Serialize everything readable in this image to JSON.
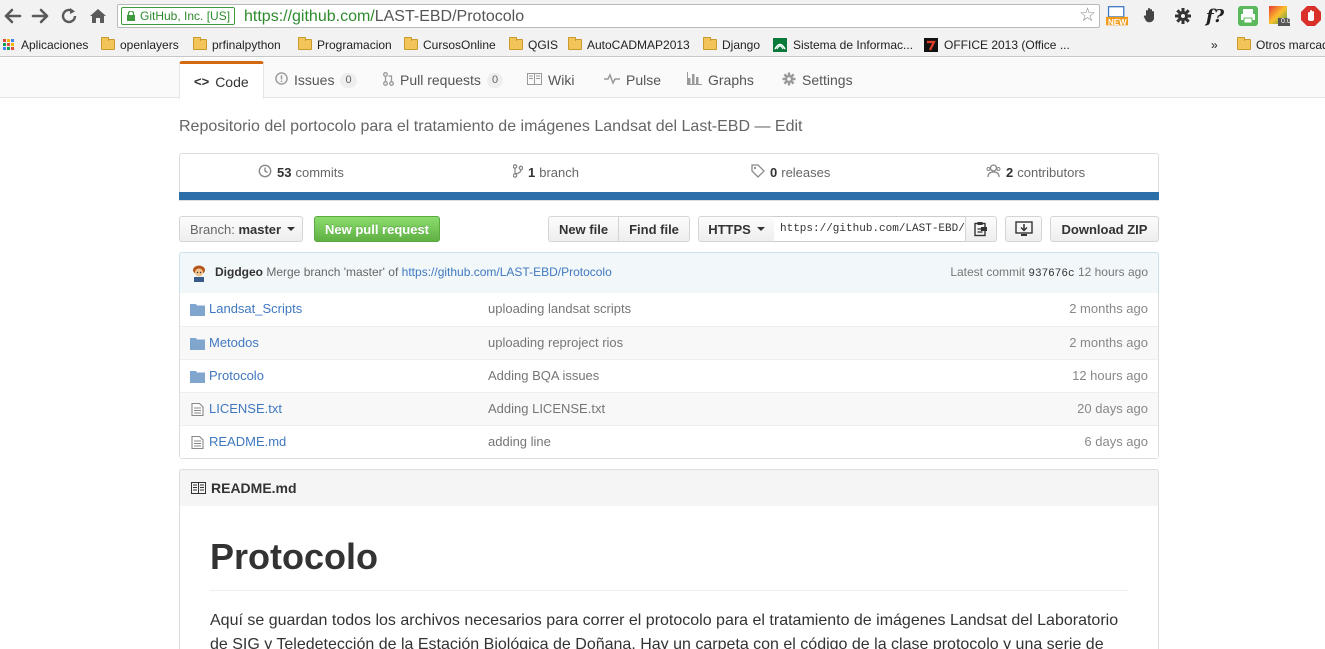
{
  "browser": {
    "ev_badge": "GitHub, Inc. [US]",
    "url_scheme_host": "https://github.com/",
    "url_path": "LAST-EBD/Protocolo",
    "ext_new_badge": "NEW",
    "ext_f_label": "f?",
    "ext_chart_badge": "0.0"
  },
  "bookmarks": {
    "apps": "Aplicaciones",
    "items": [
      "openlayers",
      "prfinalpython",
      "Programacion",
      "CursosOnline",
      "QGIS",
      "AutoCADMAP2013",
      "Django",
      "Sistema de Informac...",
      "OFFICE 2013 (Office ..."
    ],
    "overflow": "»",
    "other": "Otros marcadores"
  },
  "repo_nav": {
    "code": "Code",
    "issues": "Issues",
    "issues_count": "0",
    "pull_requests": "Pull requests",
    "pull_requests_count": "0",
    "wiki": "Wiki",
    "pulse": "Pulse",
    "graphs": "Graphs",
    "settings": "Settings"
  },
  "repo": {
    "description": "Repositorio del portocolo para el tratamiento de imágenes Landsat del Last-EBD",
    "edit_sep": " — ",
    "edit": "Edit"
  },
  "numbers": {
    "commits_count": "53",
    "commits_label": "commits",
    "branch_count": "1",
    "branch_label": "branch",
    "releases_count": "0",
    "releases_label": "releases",
    "contributors_count": "2",
    "contributors_label": "contributors"
  },
  "file_nav": {
    "branch_prefix": "Branch:",
    "branch_name": "master",
    "new_pull_request": "New pull request",
    "new_file": "New file",
    "find_file": "Find file",
    "protocol": "HTTPS",
    "clone_url": "https://github.com/LAST-EBD/Protocolo.git",
    "download_zip": "Download ZIP"
  },
  "commit": {
    "author": "Digdgeo",
    "message": "Merge branch 'master' of",
    "link": "https://github.com/LAST-EBD/Protocolo",
    "latest_label": "Latest commit",
    "sha": "937676c",
    "age": "12 hours ago"
  },
  "files": [
    {
      "type": "dir",
      "name": "Landsat_Scripts",
      "message": "uploading landsat scripts",
      "age": "2 months ago"
    },
    {
      "type": "dir",
      "name": "Metodos",
      "message": "uploading reproject rios",
      "age": "2 months ago"
    },
    {
      "type": "dir",
      "name": "Protocolo",
      "message": "Adding BQA issues",
      "age": "12 hours ago"
    },
    {
      "type": "file",
      "name": "LICENSE.txt",
      "message": "Adding LICENSE.txt",
      "age": "20 days ago"
    },
    {
      "type": "file",
      "name": "README.md",
      "message": "adding line",
      "age": "6 days ago"
    }
  ],
  "readme": {
    "filename": "README.md",
    "title": "Protocolo",
    "paragraph": "Aquí se guardan todos los archivos necesarios para correr el protocolo para el tratamiento de imágenes Landsat del Laboratorio de SIG y Teledetección de la Estación Biológica de Doñana. Hay un carpeta con el código de la clase protocolo y una serie de"
  },
  "colors": {
    "accent_tab": "#d26911",
    "link": "#4078c0",
    "green_button": "#60b044",
    "progress_bar": "#2b6ea8",
    "ev_green": "#2e8b2e"
  }
}
